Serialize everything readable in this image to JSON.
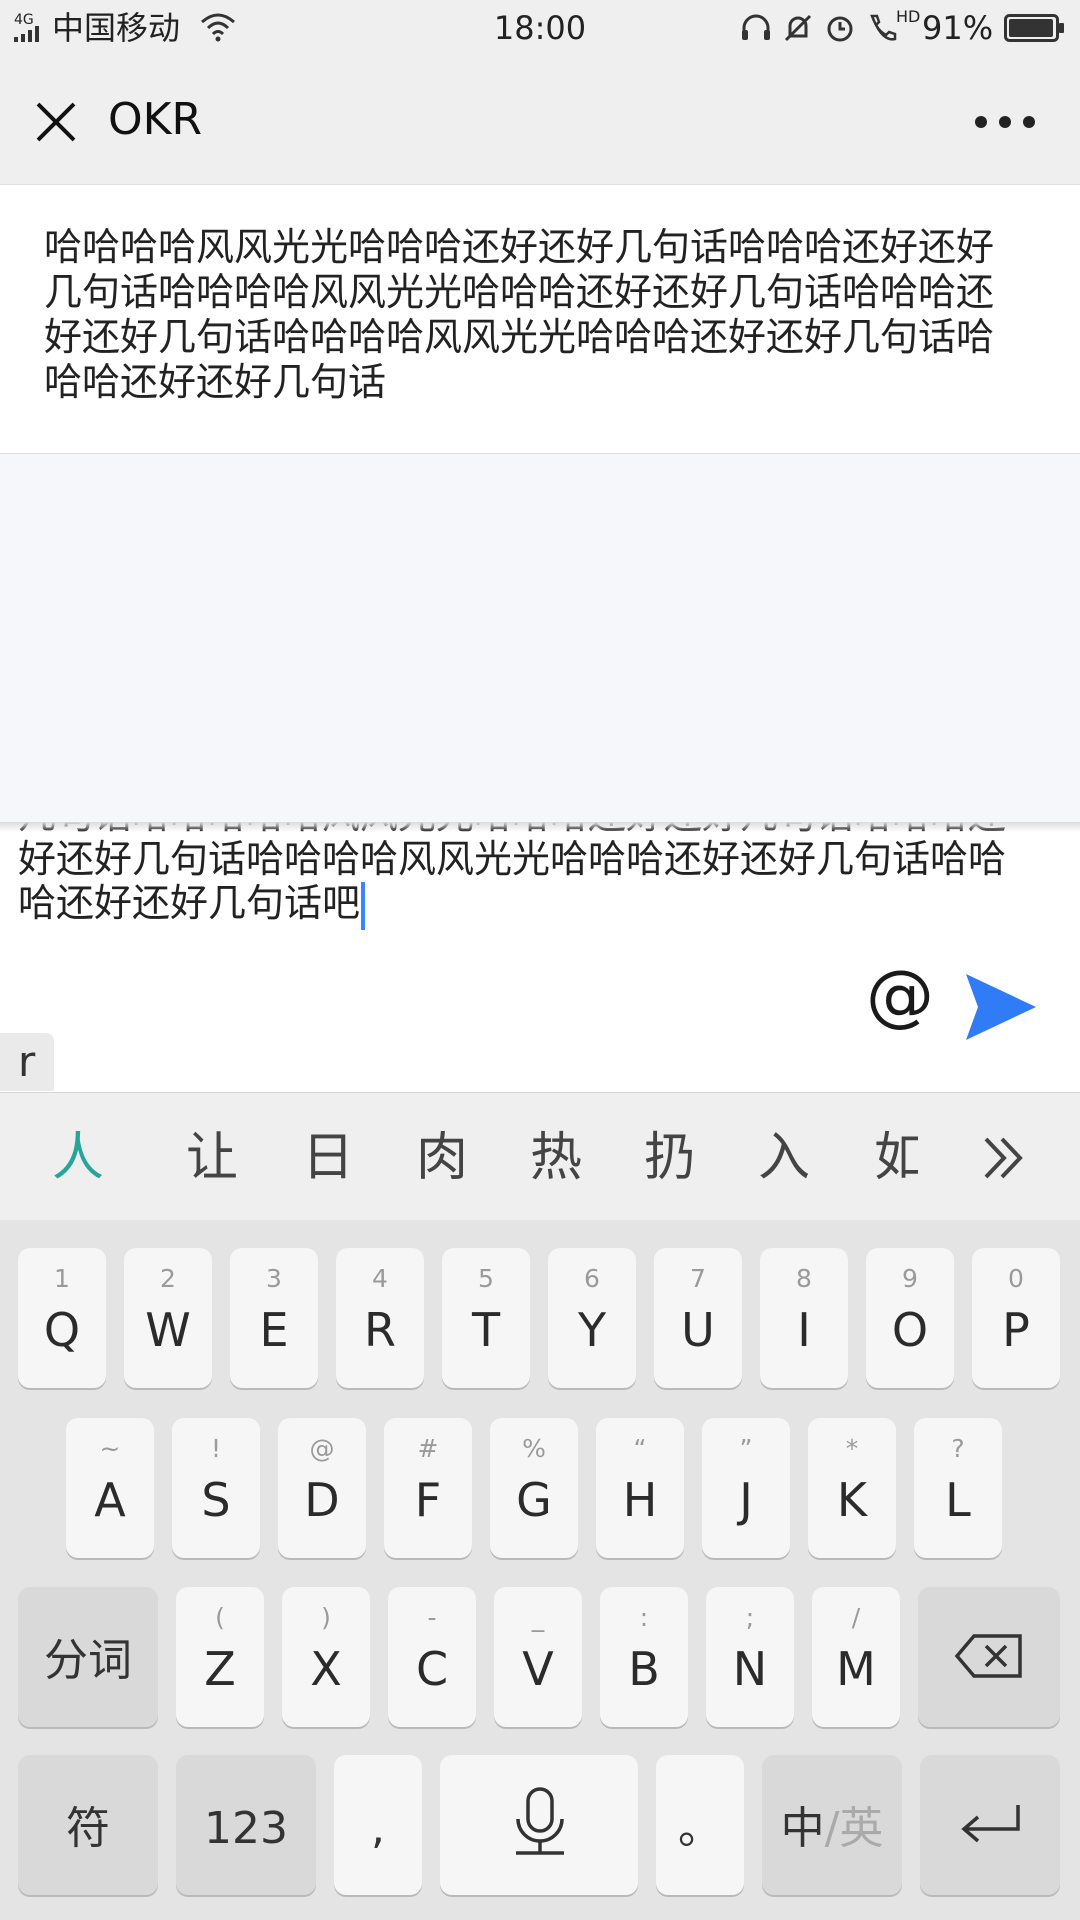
{
  "status_bar": {
    "network": "4G",
    "carrier": "中国移动",
    "time": "18:00",
    "hd_label": "HD",
    "battery": "91%"
  },
  "nav": {
    "title": "OKR"
  },
  "message": {
    "text": "哈哈哈哈风风光光哈哈哈还好还好几句话哈哈哈还好还好几句话哈哈哈哈风风光光哈哈哈还好还好几句话哈哈哈还好还好几句话哈哈哈哈风风光光哈哈哈还好还好几句话哈哈哈还好还好几句话"
  },
  "composer": {
    "text": "几句话哈哈哈哈哈风风光光哈哈哈还好还好几句话哈哈哈还好还好几句话哈哈哈哈风风光光哈哈哈还好还好几句话哈哈哈还好还好几句话吧",
    "at_label": "@",
    "ime_composing": "r"
  },
  "candidates": [
    "人",
    "让",
    "日",
    "肉",
    "热",
    "扔",
    "入",
    "如"
  ],
  "keyboard": {
    "row1": [
      {
        "main": "Q",
        "hint": "1"
      },
      {
        "main": "W",
        "hint": "2"
      },
      {
        "main": "E",
        "hint": "3"
      },
      {
        "main": "R",
        "hint": "4"
      },
      {
        "main": "T",
        "hint": "5"
      },
      {
        "main": "Y",
        "hint": "6"
      },
      {
        "main": "U",
        "hint": "7"
      },
      {
        "main": "I",
        "hint": "8"
      },
      {
        "main": "O",
        "hint": "9"
      },
      {
        "main": "P",
        "hint": "0"
      }
    ],
    "row2": [
      {
        "main": "A",
        "hint": "~"
      },
      {
        "main": "S",
        "hint": "!"
      },
      {
        "main": "D",
        "hint": "@"
      },
      {
        "main": "F",
        "hint": "#"
      },
      {
        "main": "G",
        "hint": "%"
      },
      {
        "main": "H",
        "hint": "“"
      },
      {
        "main": "J",
        "hint": "”"
      },
      {
        "main": "K",
        "hint": "*"
      },
      {
        "main": "L",
        "hint": "?"
      }
    ],
    "row3": [
      {
        "main": "Z",
        "hint": "("
      },
      {
        "main": "X",
        "hint": ")"
      },
      {
        "main": "C",
        "hint": "-"
      },
      {
        "main": "V",
        "hint": "_"
      },
      {
        "main": "B",
        "hint": ":"
      },
      {
        "main": "N",
        "hint": ";"
      },
      {
        "main": "M",
        "hint": "/"
      }
    ],
    "segment_label": "分词",
    "symbol_label": "符",
    "numbers_label": "123",
    "comma_label": ",",
    "period_label": "。",
    "lang_zh": "中",
    "lang_sep": "/",
    "lang_en": "英"
  }
}
